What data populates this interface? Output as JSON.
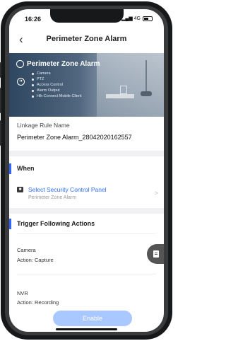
{
  "status": {
    "time": "16:26",
    "signal": "▂▄▆ 4G"
  },
  "nav": {
    "back_icon": "‹",
    "title": "Perimeter Zone Alarm"
  },
  "banner": {
    "title": "Perimeter Zone Alarm",
    "items": [
      "Camera",
      "PTZ",
      "Access Control",
      "Alarm Output",
      "Hik-Connect Mobile Client"
    ]
  },
  "rule": {
    "label": "Linkage Rule Name",
    "value": "Perimeter Zone Alarm_28042020162557"
  },
  "when": {
    "header": "When",
    "panel_title": "Select Security Control Panel",
    "panel_sub": "Perimeter Zone Alarm",
    "chevron": ">"
  },
  "trigger": {
    "header": "Trigger Following Actions",
    "actions": [
      {
        "device": "Camera",
        "action": "Action: Capture"
      },
      {
        "device": "NVR",
        "action": "Action: Recording"
      }
    ]
  },
  "enable_label": "Enable",
  "colors": {
    "accent": "#2f63ff",
    "link": "#2b6bff",
    "enable_bg": "#a9c8ff"
  }
}
